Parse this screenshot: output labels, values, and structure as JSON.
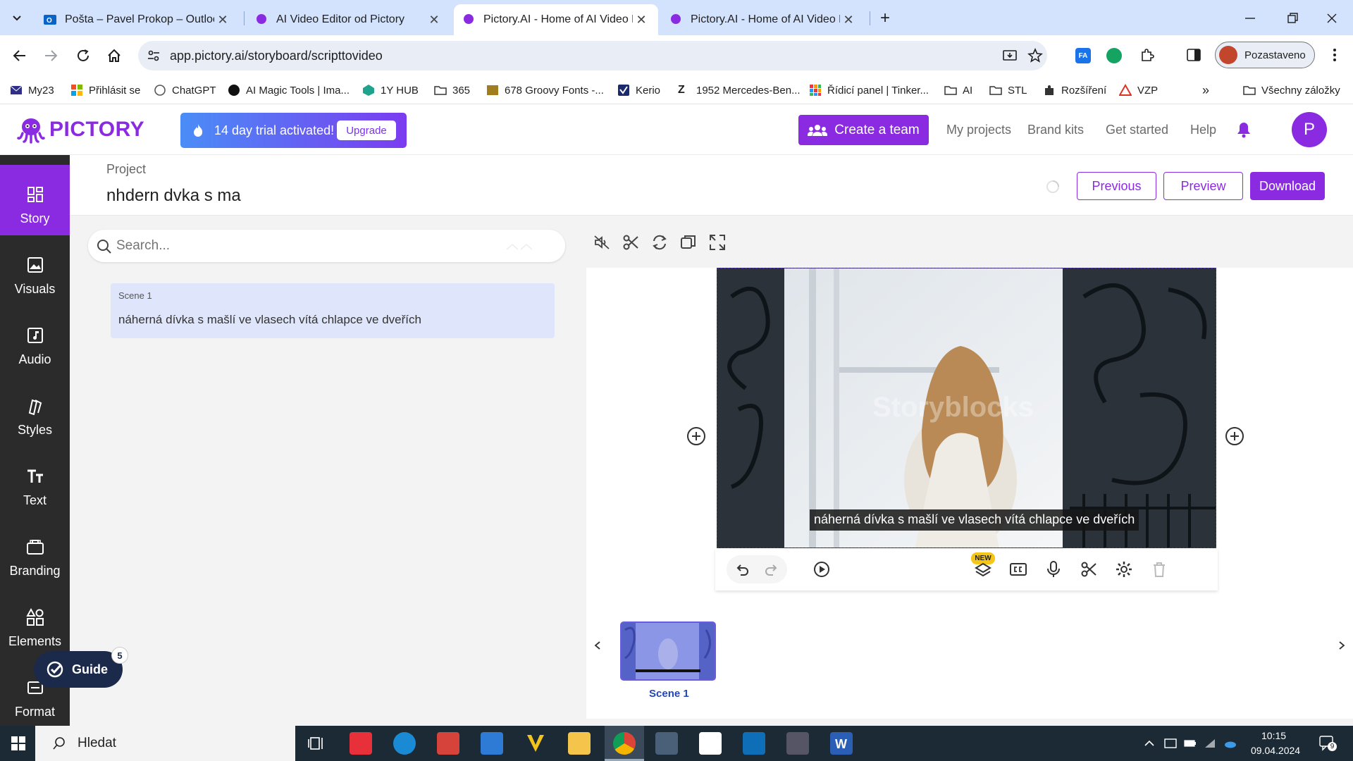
{
  "browser": {
    "tabs": [
      {
        "title": "Pošta – Pavel Prokop – Outlook",
        "active": false
      },
      {
        "title": "AI Video Editor od Pictory",
        "active": false
      },
      {
        "title": "Pictory.AI - Home of AI Video E",
        "active": true
      },
      {
        "title": "Pictory.AI - Home of AI Video E",
        "active": false
      }
    ],
    "new_tab": "+",
    "url": "app.pictory.ai/storyboard/scripttovideo",
    "profile_label": "Pozastaveno",
    "bookmarks": [
      "My23",
      "Přihlásit se",
      "ChatGPT",
      "AI Magic Tools | Ima...",
      "1Y HUB",
      "365",
      "678 Groovy Fonts -...",
      "Kerio",
      "1952 Mercedes-Ben...",
      "Řídicí panel | Tinker...",
      "AI",
      "STL",
      "Rozšíření",
      "VZP"
    ],
    "bookmarks_overflow": "»",
    "all_bookmarks": "Všechny záložky"
  },
  "app": {
    "logo": "PICTORY",
    "trial_text": "14 day trial activated!",
    "upgrade_label": "Upgrade",
    "create_team_label": "Create a team",
    "nav": [
      "My projects",
      "Brand kits",
      "Get started",
      "Help"
    ],
    "avatar_letter": "P",
    "project_label": "Project",
    "project_name": "nhdern dvka s ma",
    "previous_label": "Previous",
    "preview_label": "Preview",
    "download_label": "Download",
    "accent_color": "#8a2be2"
  },
  "sidebar": {
    "items": [
      {
        "label": "Story",
        "icon": "grid-icon",
        "active": true
      },
      {
        "label": "Visuals",
        "icon": "image-icon",
        "active": false
      },
      {
        "label": "Audio",
        "icon": "music-note-icon",
        "active": false
      },
      {
        "label": "Styles",
        "icon": "styles-icon",
        "active": false
      },
      {
        "label": "Text",
        "icon": "text-icon",
        "active": false
      },
      {
        "label": "Branding",
        "icon": "briefcase-icon",
        "active": false
      },
      {
        "label": "Elements",
        "icon": "shapes-icon",
        "active": false
      },
      {
        "label": "Format",
        "icon": "format-icon",
        "active": false
      }
    ]
  },
  "story": {
    "search_placeholder": "Search...",
    "scenes": [
      {
        "label": "Scene 1",
        "text": "náherná dívka s mašlí ve vlasech vítá chlapce ve dveřích"
      }
    ]
  },
  "preview": {
    "caption": "náherná dívka s mašlí ve vlasech vítá chlapce ve dveřích",
    "watermark": "Storyblocks",
    "new_badge": "NEW",
    "thumb_label": "Scene 1"
  },
  "guide": {
    "label": "Guide",
    "count": "5"
  },
  "taskbar": {
    "search_text": "Hledat",
    "time": "10:15",
    "date": "09.04.2024",
    "notif_count": "9"
  }
}
